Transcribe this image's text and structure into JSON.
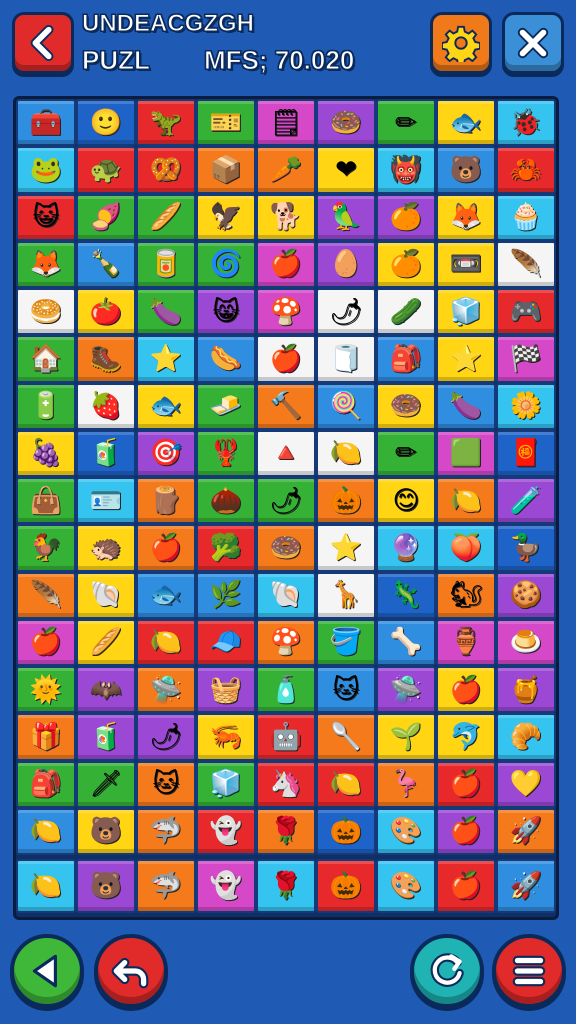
{
  "header": {
    "title_line1": "UNDEACGZGH",
    "title_line2_left": "PUZL",
    "title_line2_right": "MFS; 70.020"
  },
  "buttons": {
    "back": {
      "icon": "back-arrow-icon",
      "color": "#e12a2a"
    },
    "settings": {
      "icon": "gear-icon",
      "color": "#f07a1a"
    },
    "close": {
      "icon": "close-icon",
      "color": "#3a8fd6"
    },
    "previous": {
      "icon": "triangle-left-icon",
      "color": "#3fb83a"
    },
    "undo": {
      "icon": "undo-arrow-icon",
      "color": "#e12a2a"
    },
    "refresh": {
      "icon": "refresh-icon",
      "color": "#1fb3b3"
    },
    "menu": {
      "icon": "menu-icon",
      "color": "#e12a2a"
    }
  },
  "palette": {
    "R": "#e8292b",
    "O": "#f47a1c",
    "Y": "#ffd514",
    "G": "#35b235",
    "B": "#2f8ee0",
    "P": "#9b49d4",
    "C": "#35c3ef",
    "W": "#f5f5f5",
    "M": "#d548c8",
    "D": "#1e63c8"
  },
  "board": {
    "rows": [
      [
        "BDRGMPGYCCRROOYCB",
        "RRGGYYPPYCGBGGMPYY"
      ],
      [
        "WWYGPMWWYRGOCB",
        "WWBYMGWYGOBYBC"
      ],
      [
        "YDPGWWGMD",
        "GCOGGOYOPG"
      ],
      [
        "YOROWCCDO",
        "YBBCWDOPMY"
      ],
      [
        "RROGBMMGP",
        "OPGBPYPOPPY"
      ],
      [
        "ROYYCGGOG",
        "RRORPBYOROD"
      ],
      [
        "CPOMCRCRBP"
      ]
    ],
    "tile_icons": [
      "🧰",
      "🙂",
      "🦖",
      "🎫",
      "🗒",
      "🍩",
      "✏",
      "🐟",
      "🐞",
      "🐸",
      "🐢",
      "🥨",
      "📦",
      "🥕",
      "❤",
      "👹",
      "🐻",
      "🦀",
      "😺",
      "🍠",
      "🥖",
      "🦅",
      "🐕",
      "🦜",
      "🍊",
      "🦊",
      "🧁",
      "🦊",
      "🍾",
      "🥫",
      "🌀",
      "🍎",
      "🥚",
      "🍊",
      "📼",
      "🪶",
      "🥯",
      "🍅",
      "🍆",
      "😸",
      "🍄",
      "🌶",
      "🥒",
      "🧊",
      "🎮",
      "🏠",
      "🥾",
      "⭐",
      "🌭",
      "🍎",
      "🧻",
      "🎒",
      "⭐",
      "🏁",
      "🔋",
      "🍓",
      "🐟",
      "🧈",
      "🔨",
      "🍭",
      "🍩",
      "🍆",
      "🌼",
      "🍇",
      "🧃",
      "🎯",
      "🦞",
      "🔺",
      "🍋",
      "✏",
      "🟩",
      "🧧",
      "👜",
      "🪪",
      "🪵",
      "🌰",
      "🌶",
      "🎃",
      "😊",
      "🍋",
      "🧪",
      "🐓",
      "🦔",
      "🍎",
      "🥦",
      "🍩",
      "⭐",
      "🔮",
      "🍑",
      "🦆",
      "🪶",
      "🐚",
      "🐟",
      "🌿",
      "🐚",
      "🦒",
      "🦎",
      "🐿",
      "🍪",
      "🍎",
      "🥖",
      "🍋",
      "🧢",
      "🍄",
      "🪣",
      "🦴",
      "🏺",
      "🍮",
      "🌞",
      "🦇",
      "🛸",
      "🧺",
      "🧴",
      "🐱",
      "🛸",
      "🍎",
      "🍯",
      "🎁",
      "🧃",
      "🌶",
      "🦐",
      "🤖",
      "🥄",
      "🌱",
      "🐬",
      "🥐",
      "🎒",
      "🗡",
      "🐱",
      "🧊",
      "🦄",
      "🍋",
      "🦩",
      "🍎",
      "💛",
      "🍋",
      "🐻",
      "🦈",
      "👻",
      "🌹",
      "🎃",
      "🎨",
      "🍎",
      "🚀"
    ]
  }
}
